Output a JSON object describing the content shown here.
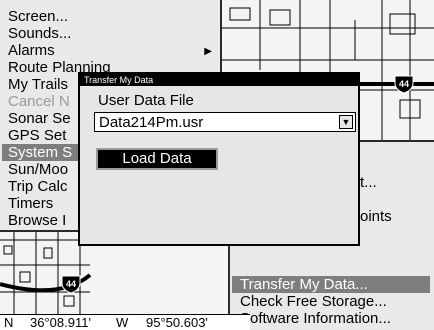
{
  "main_menu": {
    "items": [
      {
        "label": "Screen..."
      },
      {
        "label": "Sounds..."
      },
      {
        "label": "Alarms"
      },
      {
        "label": "Route Planning"
      },
      {
        "label": "My Trails"
      },
      {
        "label": "Cancel N"
      },
      {
        "label": "Sonar Se"
      },
      {
        "label": "GPS Set"
      },
      {
        "label": "System S"
      },
      {
        "label": "Sun/Moo"
      },
      {
        "label": "Trip Calc"
      },
      {
        "label": "Timers"
      },
      {
        "label": "Browse I"
      }
    ]
  },
  "sub_menu": {
    "partial_1": "t...",
    "partial_2": "oints",
    "items": [
      {
        "label": "Transfer My Data..."
      },
      {
        "label": "Check Free Storage..."
      },
      {
        "label": "Software Information..."
      }
    ]
  },
  "dialog": {
    "title": "Transfer My Data",
    "file_label": "User Data File",
    "file_value": "Data214Pm.usr",
    "load_label": "Load Data"
  },
  "status": {
    "lat_hemi": "N",
    "lat": "36°08.911'",
    "lon_hemi": "W",
    "lon": "95°50.603'"
  },
  "map": {
    "shield_number": "44"
  },
  "colors": {
    "menu_bg": "#e9e9e9",
    "selected_bg": "#7e7e7e",
    "title_bg": "#000000"
  }
}
